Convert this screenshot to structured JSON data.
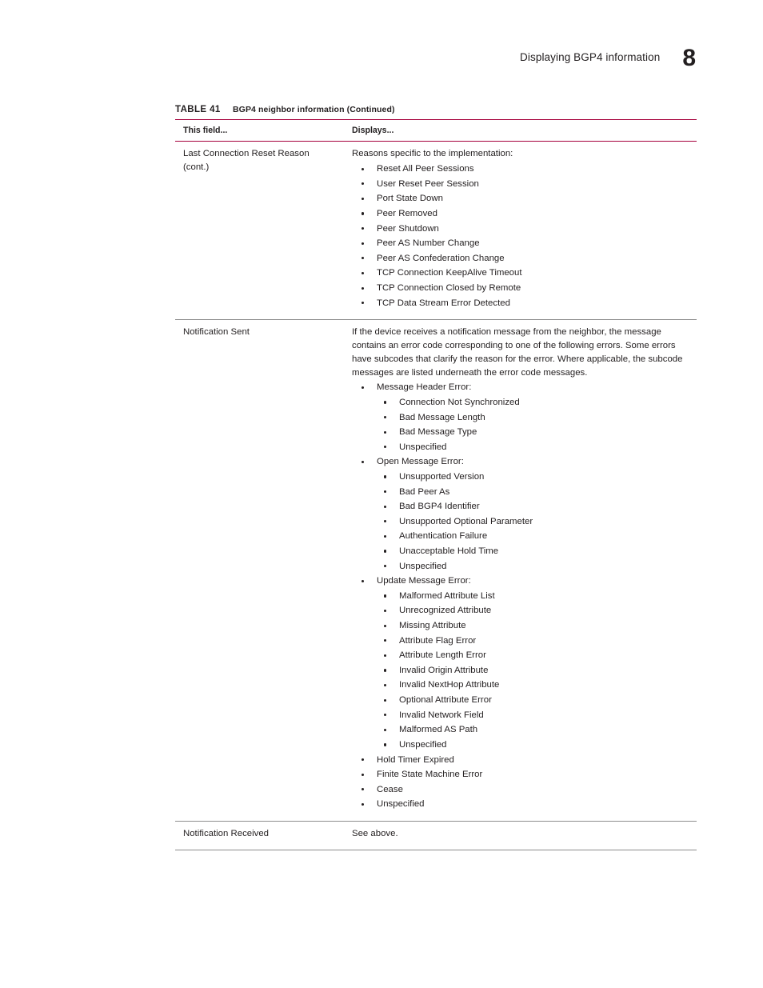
{
  "header": {
    "title": "Displaying BGP4 information",
    "page_number": "8"
  },
  "table": {
    "caption_label": "TABLE 41",
    "caption_text": "BGP4 neighbor information  (Continued)",
    "columns": {
      "field": "This field...",
      "displays": "Displays..."
    },
    "rows": [
      {
        "field_line1": "Last Connection Reset Reason",
        "field_line2": "(cont.)",
        "intro": "Reasons specific to the implementation:",
        "items": [
          "Reset All Peer Sessions",
          "User Reset Peer Session",
          "Port State Down",
          "Peer Removed",
          "Peer Shutdown",
          "Peer AS Number Change",
          "Peer AS Confederation Change",
          "TCP Connection KeepAlive Timeout",
          "TCP Connection Closed by Remote",
          "TCP Data Stream Error Detected"
        ]
      },
      {
        "field_line1": "Notification Sent",
        "intro": "If the device receives a notification message from the neighbor, the message contains an error code corresponding to one of the following errors. Some errors have subcodes that clarify the reason for the error. Where applicable, the subcode messages are listed underneath the error code messages.",
        "groups": [
          {
            "label": "Message Header Error:",
            "subitems": [
              "Connection Not Synchronized",
              "Bad Message Length",
              "Bad Message Type",
              "Unspecified"
            ]
          },
          {
            "label": "Open Message Error:",
            "subitems": [
              "Unsupported Version",
              "Bad Peer As",
              "Bad BGP4 Identifier",
              "Unsupported Optional Parameter",
              "Authentication Failure",
              "Unacceptable Hold Time",
              "Unspecified"
            ]
          },
          {
            "label": "Update Message Error:",
            "subitems": [
              "Malformed Attribute List",
              "Unrecognized Attribute",
              "Missing Attribute",
              "Attribute Flag Error",
              "Attribute Length Error",
              "Invalid Origin Attribute",
              "Invalid NextHop Attribute",
              "Optional Attribute Error",
              "Invalid Network Field",
              "Malformed AS Path",
              "Unspecified"
            ]
          },
          {
            "label": "Hold Timer Expired",
            "subitems": []
          },
          {
            "label": "Finite State Machine Error",
            "subitems": []
          },
          {
            "label": "Cease",
            "subitems": []
          },
          {
            "label": "Unspecified",
            "subitems": []
          }
        ]
      },
      {
        "field_line1": "Notification Received",
        "intro": "See above."
      }
    ]
  }
}
